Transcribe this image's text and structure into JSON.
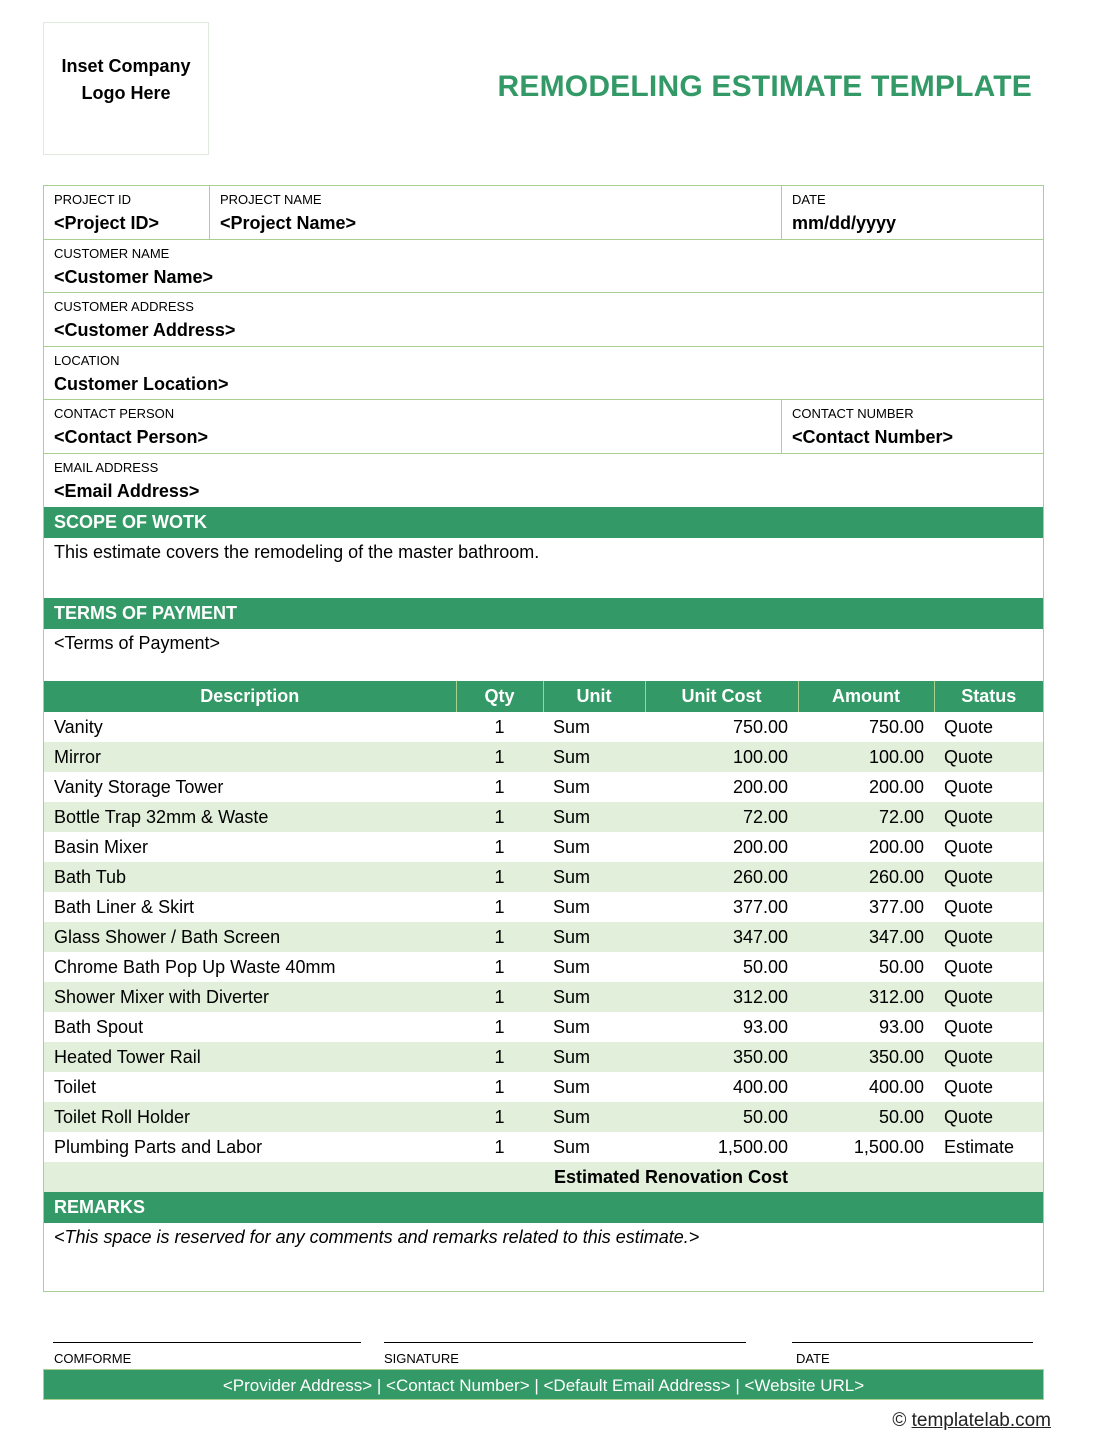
{
  "logo_placeholder": "Inset Company Logo Here",
  "title": "REMODELING ESTIMATE TEMPLATE",
  "colors": {
    "accent": "#339966",
    "border": "#a9d08e",
    "row_alt": "#e2efda"
  },
  "fields": {
    "project_id": {
      "label": "PROJECT ID",
      "value": "<Project ID>"
    },
    "project_name": {
      "label": "PROJECT NAME",
      "value": "<Project Name>"
    },
    "date": {
      "label": "DATE",
      "value": "mm/dd/yyyy"
    },
    "customer_name": {
      "label": "CUSTOMER NAME",
      "value": "<Customer Name>"
    },
    "customer_address": {
      "label": "CUSTOMER ADDRESS",
      "value": "<Customer Address>"
    },
    "location": {
      "label": "LOCATION",
      "value": "Customer Location>"
    },
    "contact_person": {
      "label": "CONTACT PERSON",
      "value": "<Contact Person>"
    },
    "contact_number": {
      "label": "CONTACT NUMBER",
      "value": "<Contact Number>"
    },
    "email_address": {
      "label": "EMAIL ADDRESS",
      "value": "<Email Address>"
    }
  },
  "scope": {
    "heading": "SCOPE OF WOTK",
    "text": "This estimate covers the remodeling of the master bathroom."
  },
  "terms": {
    "heading": "TERMS OF PAYMENT",
    "text": "<Terms of Payment>"
  },
  "items_table": {
    "columns": [
      "Description",
      "Qty",
      "Unit",
      "Unit Cost",
      "Amount",
      "Status"
    ],
    "rows": [
      {
        "description": "Vanity",
        "qty": "1",
        "unit": "Sum",
        "unit_cost": "750.00",
        "amount": "750.00",
        "status": "Quote"
      },
      {
        "description": "Mirror",
        "qty": "1",
        "unit": "Sum",
        "unit_cost": "100.00",
        "amount": "100.00",
        "status": "Quote"
      },
      {
        "description": "Vanity Storage Tower",
        "qty": "1",
        "unit": "Sum",
        "unit_cost": "200.00",
        "amount": "200.00",
        "status": "Quote"
      },
      {
        "description": "Bottle Trap 32mm & Waste",
        "qty": "1",
        "unit": "Sum",
        "unit_cost": "72.00",
        "amount": "72.00",
        "status": "Quote"
      },
      {
        "description": "Basin Mixer",
        "qty": "1",
        "unit": "Sum",
        "unit_cost": "200.00",
        "amount": "200.00",
        "status": "Quote"
      },
      {
        "description": "Bath Tub",
        "qty": "1",
        "unit": "Sum",
        "unit_cost": "260.00",
        "amount": "260.00",
        "status": "Quote"
      },
      {
        "description": "Bath Liner & Skirt",
        "qty": "1",
        "unit": "Sum",
        "unit_cost": "377.00",
        "amount": "377.00",
        "status": "Quote"
      },
      {
        "description": "Glass Shower / Bath Screen",
        "qty": "1",
        "unit": "Sum",
        "unit_cost": "347.00",
        "amount": "347.00",
        "status": "Quote"
      },
      {
        "description": "Chrome Bath Pop Up Waste 40mm",
        "qty": "1",
        "unit": "Sum",
        "unit_cost": "50.00",
        "amount": "50.00",
        "status": "Quote"
      },
      {
        "description": "Shower Mixer with Diverter",
        "qty": "1",
        "unit": "Sum",
        "unit_cost": "312.00",
        "amount": "312.00",
        "status": "Quote"
      },
      {
        "description": "Bath Spout",
        "qty": "1",
        "unit": "Sum",
        "unit_cost": "93.00",
        "amount": "93.00",
        "status": "Quote"
      },
      {
        "description": "Heated Tower Rail",
        "qty": "1",
        "unit": "Sum",
        "unit_cost": "350.00",
        "amount": "350.00",
        "status": "Quote"
      },
      {
        "description": "Toilet",
        "qty": "1",
        "unit": "Sum",
        "unit_cost": "400.00",
        "amount": "400.00",
        "status": "Quote"
      },
      {
        "description": "Toilet Roll Holder",
        "qty": "1",
        "unit": "Sum",
        "unit_cost": "50.00",
        "amount": "50.00",
        "status": "Quote"
      },
      {
        "description": "Plumbing Parts and Labor",
        "qty": "1",
        "unit": "Sum",
        "unit_cost": "1,500.00",
        "amount": "1,500.00",
        "status": "Estimate"
      }
    ],
    "total_label": "Estimated Renovation Cost",
    "total_value": ""
  },
  "remarks": {
    "heading": "REMARKS",
    "text": "<This space is reserved for any comments and remarks related to this estimate.>"
  },
  "signatures": {
    "conforme": "COMFORME",
    "signature": "SIGNATURE",
    "date": "DATE"
  },
  "footer": "<Provider Address> | <Contact Number> | <Default Email Address> | <Website URL>",
  "credit": {
    "symbol": "©",
    "link": "templatelab.com"
  }
}
